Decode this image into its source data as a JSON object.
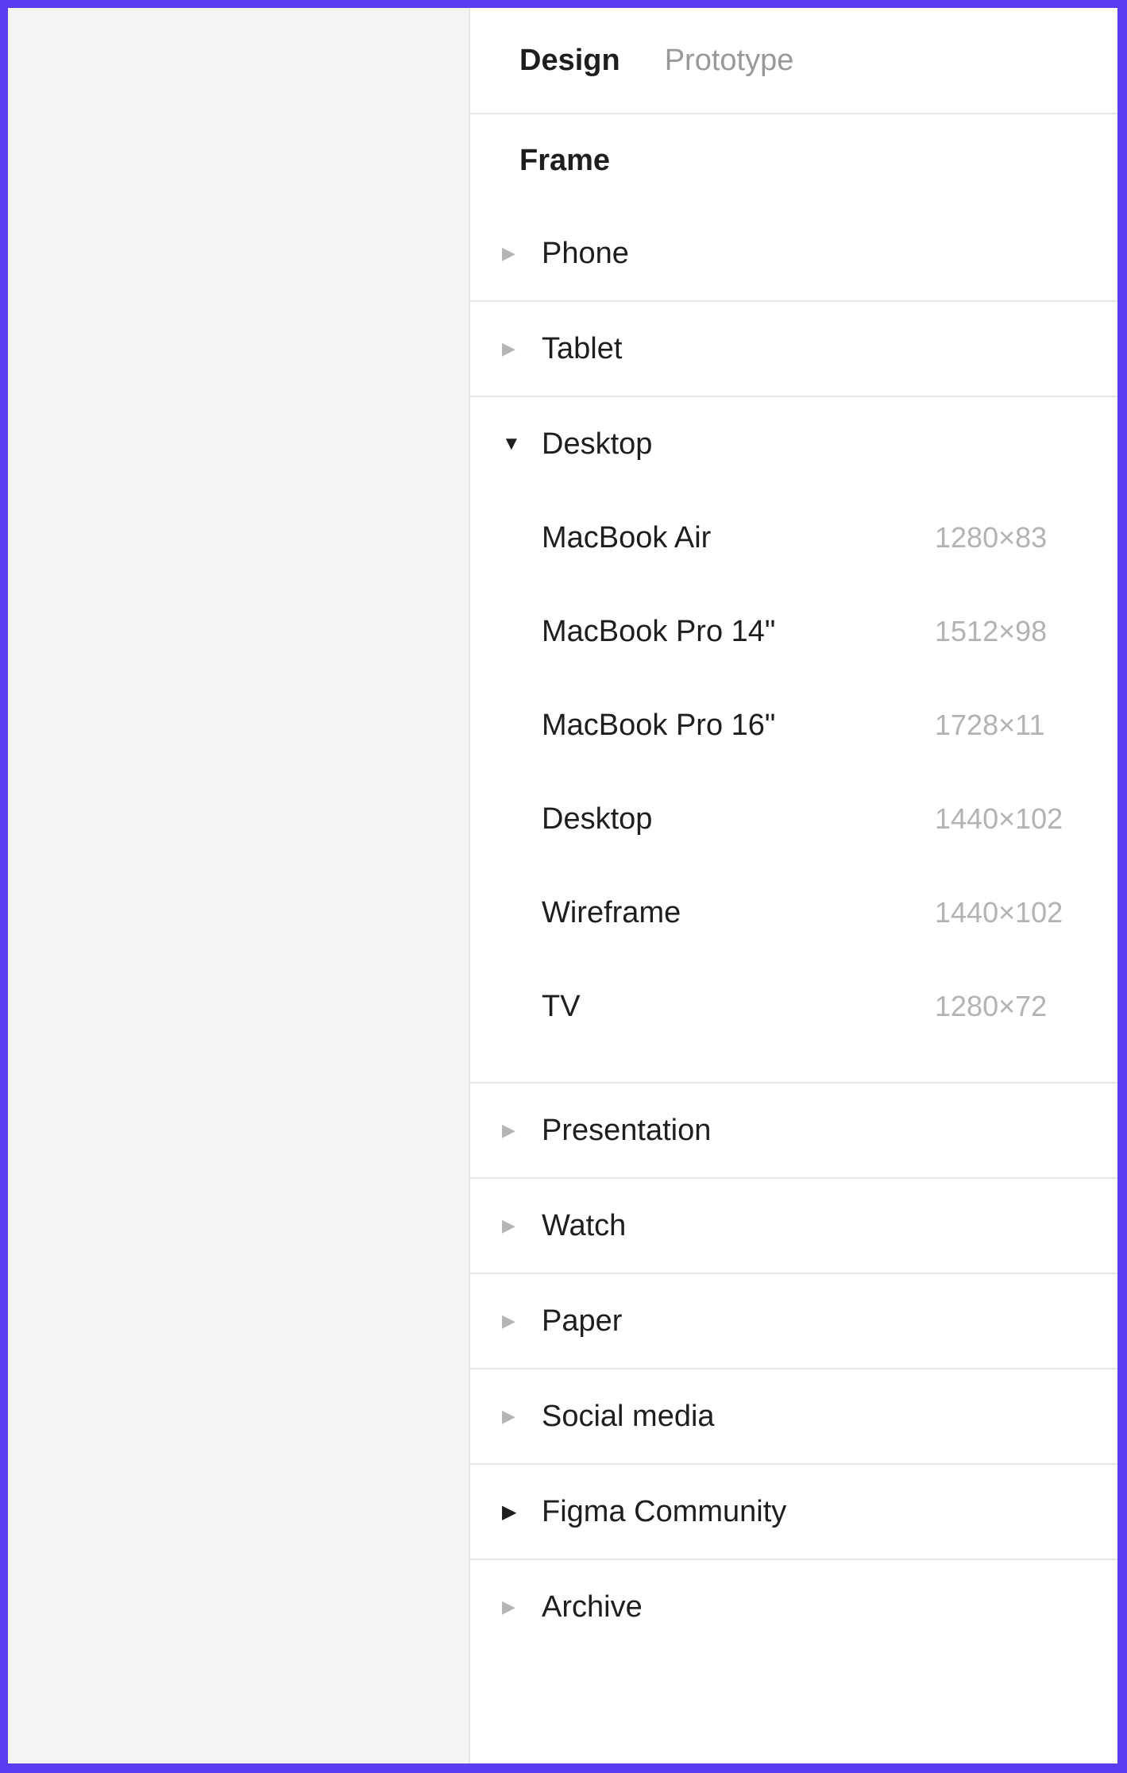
{
  "tabs": [
    {
      "label": "Design",
      "active": true
    },
    {
      "label": "Prototype",
      "active": false
    }
  ],
  "section_title": "Frame",
  "groups": [
    {
      "label": "Phone",
      "expanded": false
    },
    {
      "label": "Tablet",
      "expanded": false
    },
    {
      "label": "Desktop",
      "expanded": true,
      "items": [
        {
          "label": "MacBook Air",
          "size": "1280×83"
        },
        {
          "label": "MacBook Pro 14\"",
          "size": "1512×98"
        },
        {
          "label": "MacBook Pro 16\"",
          "size": "1728×11"
        },
        {
          "label": "Desktop",
          "size": "1440×102"
        },
        {
          "label": "Wireframe",
          "size": "1440×102"
        },
        {
          "label": "TV",
          "size": "1280×72"
        }
      ]
    },
    {
      "label": "Presentation",
      "expanded": false
    },
    {
      "label": "Watch",
      "expanded": false
    },
    {
      "label": "Paper",
      "expanded": false
    },
    {
      "label": "Social media",
      "expanded": false
    },
    {
      "label": "Figma Community",
      "expanded": false
    },
    {
      "label": "Archive",
      "expanded": false
    }
  ],
  "icons": {
    "collapsed": "caret-right-icon",
    "expanded": "caret-down-icon"
  },
  "colors": {
    "border": "#5b3cf0",
    "panel": "#ffffff",
    "canvas": "#f4f4f4",
    "text": "#1e1e1e",
    "muted": "#b3b3b3"
  }
}
